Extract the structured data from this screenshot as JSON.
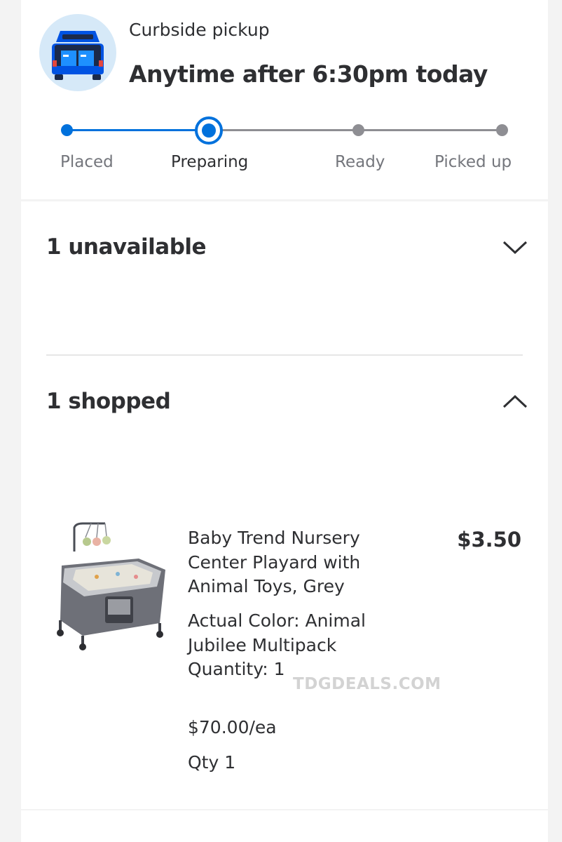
{
  "pickup": {
    "icon": "car-trunk-icon",
    "label": "Curbside pickup",
    "time": "Anytime after 6:30pm today"
  },
  "progress": {
    "current_step": "Preparing",
    "steps": [
      "Placed",
      "Preparing",
      "Ready",
      "Picked up"
    ],
    "accent_color": "#0071dc",
    "inactive_color": "#8e8e93"
  },
  "sections": {
    "unavailable": {
      "title": "1 unavailable",
      "icon": "chevron-down-icon"
    },
    "shopped": {
      "title": "1 shopped",
      "icon": "chevron-up-icon"
    }
  },
  "product": {
    "image": "playard-image",
    "name": "Baby Trend Nursery Center Playard with Animal Toys, Grey",
    "color_line": "Actual Color: Animal Jubilee Multipack",
    "quantity_line": "Quantity: 1",
    "unit_price": "$70.00/ea",
    "qty": "Qty 1",
    "price": "$3.50"
  },
  "watermark": "TDGDEALS.COM"
}
